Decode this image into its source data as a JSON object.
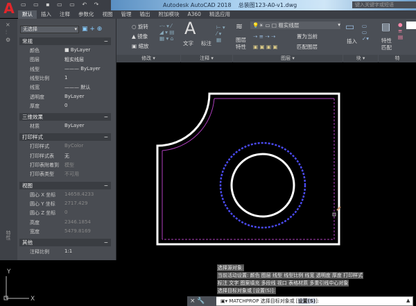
{
  "app": {
    "title": "Autodesk AutoCAD 2018",
    "file": "总装图123-A0-v1.dwg",
    "search_placeholder": "键入关键字或短语",
    "logo": "A"
  },
  "tabs": [
    "默认",
    "插入",
    "注释",
    "参数化",
    "视图",
    "管理",
    "输出",
    "附加模块",
    "A360",
    "精选应用"
  ],
  "ribbon": {
    "modify": {
      "label": "修改 ▾",
      "items": [
        "旋转",
        "镜像",
        "缩放"
      ]
    },
    "annotation": {
      "label": "注释 ▾",
      "text": "文字",
      "dim": "标注"
    },
    "layers": {
      "label": "图层 ▾",
      "current_layer": "粗实线层",
      "props": "图层\n特性",
      "set_current": "置为当前",
      "match": "匹配图层"
    },
    "block": {
      "label": "块 ▾",
      "insert": "插入"
    },
    "properties": {
      "label": "特",
      "match": "特性\n匹配"
    }
  },
  "palette": {
    "selection": "无选择",
    "sections": [
      {
        "title": "常规",
        "rows": [
          [
            "颜色",
            "■ ByLayer"
          ],
          [
            "图层",
            "粗实线层"
          ],
          [
            "线型",
            "——— ByLayer"
          ],
          [
            "线型比例",
            "1"
          ],
          [
            "线宽",
            "——— 默认"
          ],
          [
            "透明度",
            "ByLayer"
          ],
          [
            "厚度",
            "0"
          ]
        ]
      },
      {
        "title": "三维效果",
        "rows": [
          [
            "材质",
            "ByLayer"
          ]
        ]
      },
      {
        "title": "打印样式",
        "rows": [
          [
            "打印样式",
            "ByColor"
          ],
          [
            "打印样式表",
            "无"
          ],
          [
            "打印表附着到",
            "模型"
          ],
          [
            "打印表类型",
            "不可用"
          ]
        ]
      },
      {
        "title": "视图",
        "rows": [
          [
            "圆心 X 坐标",
            "14658.4233"
          ],
          [
            "圆心 Y 坐标",
            "2717.429"
          ],
          [
            "圆心 Z 坐标",
            "0"
          ],
          [
            "高度",
            "2346.1854"
          ],
          [
            "宽度",
            "5479.8169"
          ]
        ]
      },
      {
        "title": "其他",
        "rows": [
          [
            "注释比例",
            "1:1"
          ]
        ]
      }
    ],
    "side_label": "特性"
  },
  "command": {
    "history": [
      "选择源对象:",
      "当前活动设置:  颜色 图层 线型 线型比例 线宽 透明度 厚度 打印样式",
      "标注 文字 图案填充 多段线 视口 表格材质 多重引线中心对象",
      "选择目标对象或 [设置(S)]:"
    ],
    "prompt_cmd": "MATCHPROP 选择目标对象或 [",
    "prompt_opt": "设置(S)",
    "prompt_end": "]:"
  },
  "ucs": {
    "x": "X",
    "y": "Y"
  },
  "colors": {
    "outline": "#ffffff",
    "offset": "#b040c0",
    "circle_dashed": "#4a4af0"
  }
}
